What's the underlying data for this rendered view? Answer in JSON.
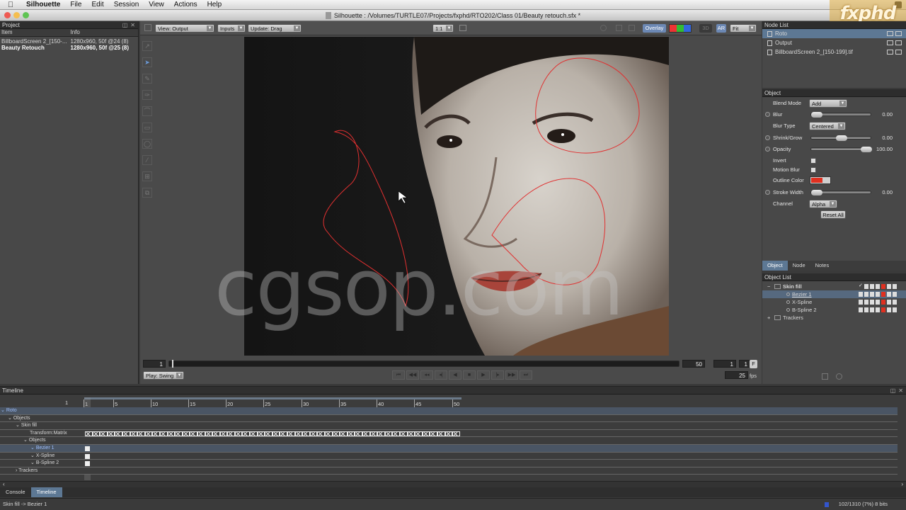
{
  "menubar": {
    "app": "Silhouette",
    "items": [
      "File",
      "Edit",
      "Session",
      "View",
      "Actions",
      "Help"
    ]
  },
  "window": {
    "title": "Silhouette : /Volumes/TURTLE07/Projects/fxphd/RTO202/Class 01/Beauty retouch.sfx *"
  },
  "brand": {
    "logo_text": "fxphd"
  },
  "project": {
    "title": "Project",
    "columns": [
      "Item",
      "Info"
    ],
    "rows": [
      {
        "item": "BillboardScreen 2_[150-...",
        "info": "1280x960, 50f @24 (8)"
      },
      {
        "item": "Beauty Retouch",
        "info": "1280x960, 50f @25 (8)"
      }
    ]
  },
  "viewer": {
    "view_drop": "View: Output",
    "inputs_drop": "Inputs",
    "update_drop": "Update: Drag",
    "zoom_drop": "1:1",
    "overlay": "Overlay",
    "three_d": "3D",
    "ar": "AR",
    "fit_drop": "Fit",
    "watermark": "cgsop.com",
    "start_frame": "1",
    "end_frame": "50",
    "current_frame": "1",
    "step": "1",
    "f_label": "F",
    "play_mode": "Play: Swing",
    "fps_value": "25",
    "fps_label": "fps"
  },
  "node_list": {
    "title": "Node List",
    "nodes": [
      "Roto",
      "Output",
      "BillboardScreen 2_[150-199].tif"
    ]
  },
  "object": {
    "title": "Object",
    "blend_mode_label": "Blend Mode",
    "blend_mode": "Add",
    "blur_label": "Blur",
    "blur_value": "0.00",
    "blur_type_label": "Blur Type",
    "blur_type": "Centered",
    "shrink_label": "Shrink/Grow",
    "shrink_value": "0.00",
    "opacity_label": "Opacity",
    "opacity_value": "100.00",
    "invert_label": "Invert",
    "motion_blur_label": "Motion Blur",
    "outline_label": "Outline Color",
    "outline_color": "#e03020",
    "stroke_label": "Stroke Width",
    "stroke_value": "0.00",
    "channel_label": "Channel",
    "channel": "Alpha",
    "reset": "Reset All",
    "tabs": [
      "Object",
      "Node",
      "Notes"
    ]
  },
  "object_list": {
    "title": "Object List",
    "items": [
      {
        "name": "Skin fill",
        "level": 1
      },
      {
        "name": "Bezier 1",
        "level": 2
      },
      {
        "name": "X-Spline",
        "level": 2
      },
      {
        "name": "B-Spline 2",
        "level": 2
      },
      {
        "name": "Trackers",
        "level": 1
      }
    ]
  },
  "timeline": {
    "title": "Timeline",
    "start": "1",
    "ticks": [
      "1",
      "5",
      "10",
      "15",
      "20",
      "25",
      "30",
      "35",
      "40",
      "45",
      "50"
    ],
    "rows": [
      "Roto",
      "Objects",
      "Skin fill",
      "Transform:Matrix",
      "Objects",
      "Bezier 1",
      "X-Spline",
      "B-Spline 2",
      "Trackers"
    ]
  },
  "bottom_tabs": [
    "Console",
    "Timeline"
  ],
  "status": {
    "left": "Skin fill -> Bezier 1",
    "right": "102/1310 (7%) 8 bits"
  },
  "colors": {
    "accent": "#5d7894",
    "spline": "#e03030",
    "panel": "#484848"
  }
}
